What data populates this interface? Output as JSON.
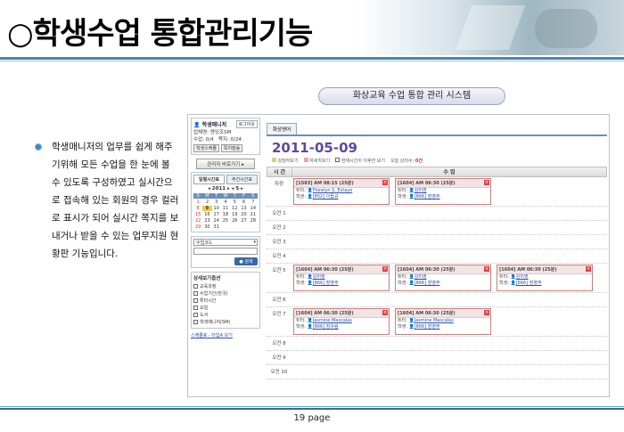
{
  "slide": {
    "title": "○학생수업 통합관리기능",
    "subtitle_pill": "화상교육 수업 통합 관리 시스템",
    "description": "학생매니저의 업무를 쉽게 해주기위해 모든 수업을 한 눈에 볼 수 있도록 구성하였고 실시간으로 접속해 있는 회원의 경우 컬러로 표시가 되어 실시간 쪽지를 보내거나 받을 수 있는 업무지원 현황판 기능입니다.",
    "page_number": "19 page"
  },
  "left_panel": {
    "manager_title": "학생매니저",
    "logout": "로그아웃",
    "manager_info": [
      "업체명: 엔잉조SM",
      "수업: 0/4",
      "쪽지: 0/24"
    ],
    "buttons": [
      "학생스케쥴",
      "쪽지발송"
    ],
    "quick_button": "관리자 바로가기 ▸",
    "tabs": [
      "일별시간표",
      "주간시간표"
    ],
    "calendar_nav": "◂ 2011 ▸ ◂ 5 ▸",
    "weekdays": [
      "S",
      "M",
      "T",
      "W",
      "T",
      "F",
      "S"
    ],
    "days": [
      "1",
      "2",
      "3",
      "4",
      "5",
      "6",
      "7",
      "8",
      "9",
      "10",
      "11",
      "12",
      "13",
      "14",
      "15",
      "16",
      "17",
      "18",
      "19",
      "20",
      "21",
      "22",
      "23",
      "24",
      "25",
      "26",
      "27",
      "28",
      "29",
      "30",
      "31"
    ],
    "today": "9",
    "select_label": "수업코드",
    "search_button": "● 검색",
    "filter_title": "상세보기옵션",
    "filters": [
      "교육과정",
      "수업기간(한국)",
      "튜터시간",
      "요일",
      "도서",
      "학생매니저(SM)"
    ],
    "bottom_link": "스케쥴표 - 타입A 보기"
  },
  "main_panel": {
    "tab": "화상영어",
    "date": "2011-05-09",
    "legend": [
      "강당하보기",
      "자세히보기",
      "현재시간이 이후한 보기",
      "오늘 강의수:"
    ],
    "lecture_count": "0건",
    "col_time": "시 간",
    "col_class": "수 업",
    "rows": [
      {
        "time": "자정",
        "cards": [
          {
            "head": "[1583] AM 08:15 (25분)",
            "tutor": "Florelyn S. Estayo",
            "student": "[852] 이듭규"
          },
          {
            "head": "[1604] AM 06:30 (25분)",
            "tutor": "김미영",
            "student": "[866] 장영주"
          }
        ]
      },
      {
        "time": "오전 1",
        "cards": []
      },
      {
        "time": "오전 2",
        "cards": []
      },
      {
        "time": "오전 3",
        "cards": []
      },
      {
        "time": "오전 4",
        "cards": []
      },
      {
        "time": "오전 5",
        "cards": [
          {
            "head": "[1604] AM 06:30 (25분)",
            "tutor": "김미영",
            "student": "[866] 장영주"
          },
          {
            "head": "[1604] AM 06:30 (25분)",
            "tutor": "김미영",
            "student": "[866] 장영주"
          },
          {
            "head": "[1604] AM 06:30 (25분)",
            "tutor": "김미영",
            "student": "[866] 장영주"
          }
        ]
      },
      {
        "time": "오전 6",
        "cards": []
      },
      {
        "time": "오전 7",
        "cards": [
          {
            "head": "[1604] AM 06:30 (25분)",
            "tutor": "Jasmine Mascalas",
            "student": "[866] 장유림"
          },
          {
            "head": "[1604] AM 06:30 (25분)",
            "tutor": "Jasmine Mascalas",
            "student": "[866] 장영주"
          }
        ]
      },
      {
        "time": "오전 8",
        "cards": []
      },
      {
        "time": "오전 9",
        "cards": []
      },
      {
        "time": "오전 10",
        "cards": []
      }
    ],
    "tutor_label": "튜터:",
    "student_label": "학생:"
  }
}
